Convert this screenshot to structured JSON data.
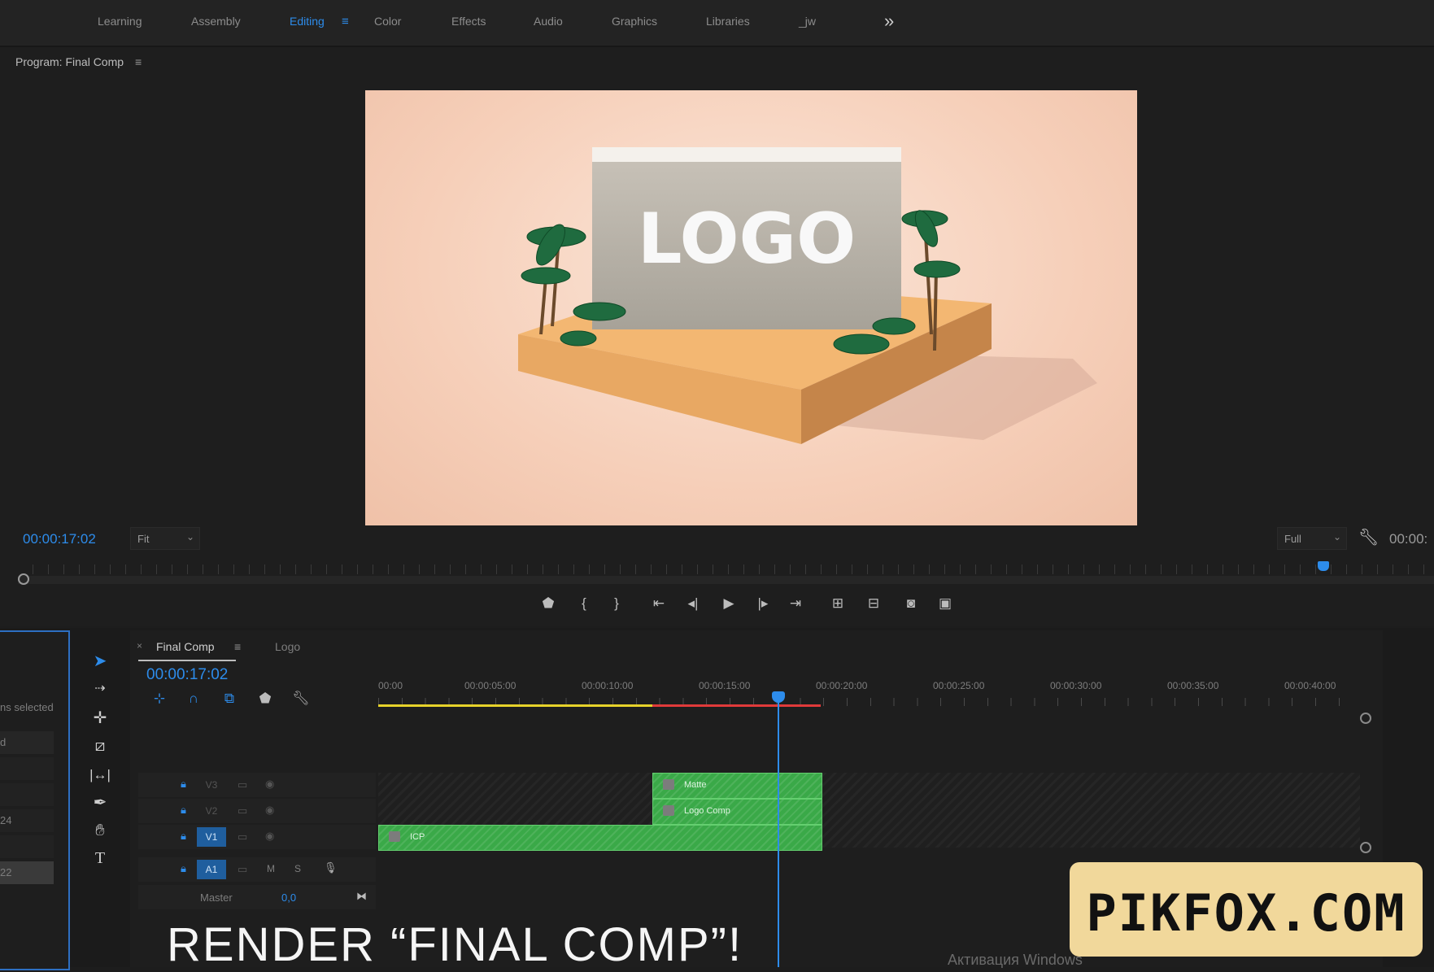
{
  "workspaces": {
    "items": [
      "Learning",
      "Assembly",
      "Editing",
      "Color",
      "Effects",
      "Audio",
      "Graphics",
      "Libraries",
      "_jw"
    ],
    "active": "Editing",
    "menu_glyph": "≡",
    "overflow_glyph": "»"
  },
  "program_monitor": {
    "title": "Program: Final Comp",
    "menu_glyph": "≡",
    "timecode": "00:00:17:02",
    "fit": "Fit",
    "quality": "Full",
    "end_timecode": "00:00:",
    "playhead_fraction": 0.94,
    "frame_text": "LOGO",
    "controls": [
      "marker-icon",
      "mark-in-icon",
      "mark-out-icon",
      "go-to-in-icon",
      "step-back-icon",
      "play-icon",
      "step-forward-icon",
      "go-to-out-icon",
      "insert-icon",
      "overwrite-icon",
      "export-frame-icon",
      "comparison-view-icon"
    ]
  },
  "project_panel": {
    "selected_text": "ns selected",
    "row_texts": [
      "d",
      "24",
      "22"
    ]
  },
  "tools": [
    "selection-tool-icon",
    "track-select-tool-icon",
    "ripple-edit-tool-icon",
    "razor-tool-icon",
    "slip-tool-icon",
    "pen-tool-icon",
    "hand-tool-icon",
    "type-tool-icon"
  ],
  "timeline": {
    "tabs": [
      {
        "label": "Final Comp",
        "active": true
      },
      {
        "label": "Logo",
        "active": false
      }
    ],
    "close_glyph": "×",
    "menu_glyph": "≡",
    "timecode": "00:00:17:02",
    "ruler": [
      "00:00",
      "00:00:05:00",
      "00:00:10:00",
      "00:00:15:00",
      "00:00:20:00",
      "00:00:25:00",
      "00:00:30:00",
      "00:00:35:00",
      "00:00:40:00"
    ],
    "playhead_seconds": 17.07,
    "tracks": [
      {
        "name": "V3",
        "target": false
      },
      {
        "name": "V2",
        "target": false
      },
      {
        "name": "V1",
        "target": true
      },
      {
        "name": "A1",
        "target": true
      }
    ],
    "audio_buttons": [
      "M",
      "S"
    ],
    "master_label": "Master",
    "master_value": "0,0",
    "clips": [
      {
        "track": "V3",
        "label": "Matte",
        "start": 11.7,
        "end": 18.9
      },
      {
        "track": "V2",
        "label": "Logo Comp",
        "start": 11.7,
        "end": 18.9
      },
      {
        "track": "V1",
        "label": "ICP",
        "start": 0,
        "end": 18.9
      }
    ]
  },
  "overlay": {
    "caption": "RENDER “FINAL COMP”!",
    "watermark": "PIKFOX.COM",
    "windows_activation": "Активация Windows"
  },
  "colors": {
    "accent": "#2d8ceb",
    "clip": "#3aa948",
    "watermark_bg": "#f1d89b"
  }
}
